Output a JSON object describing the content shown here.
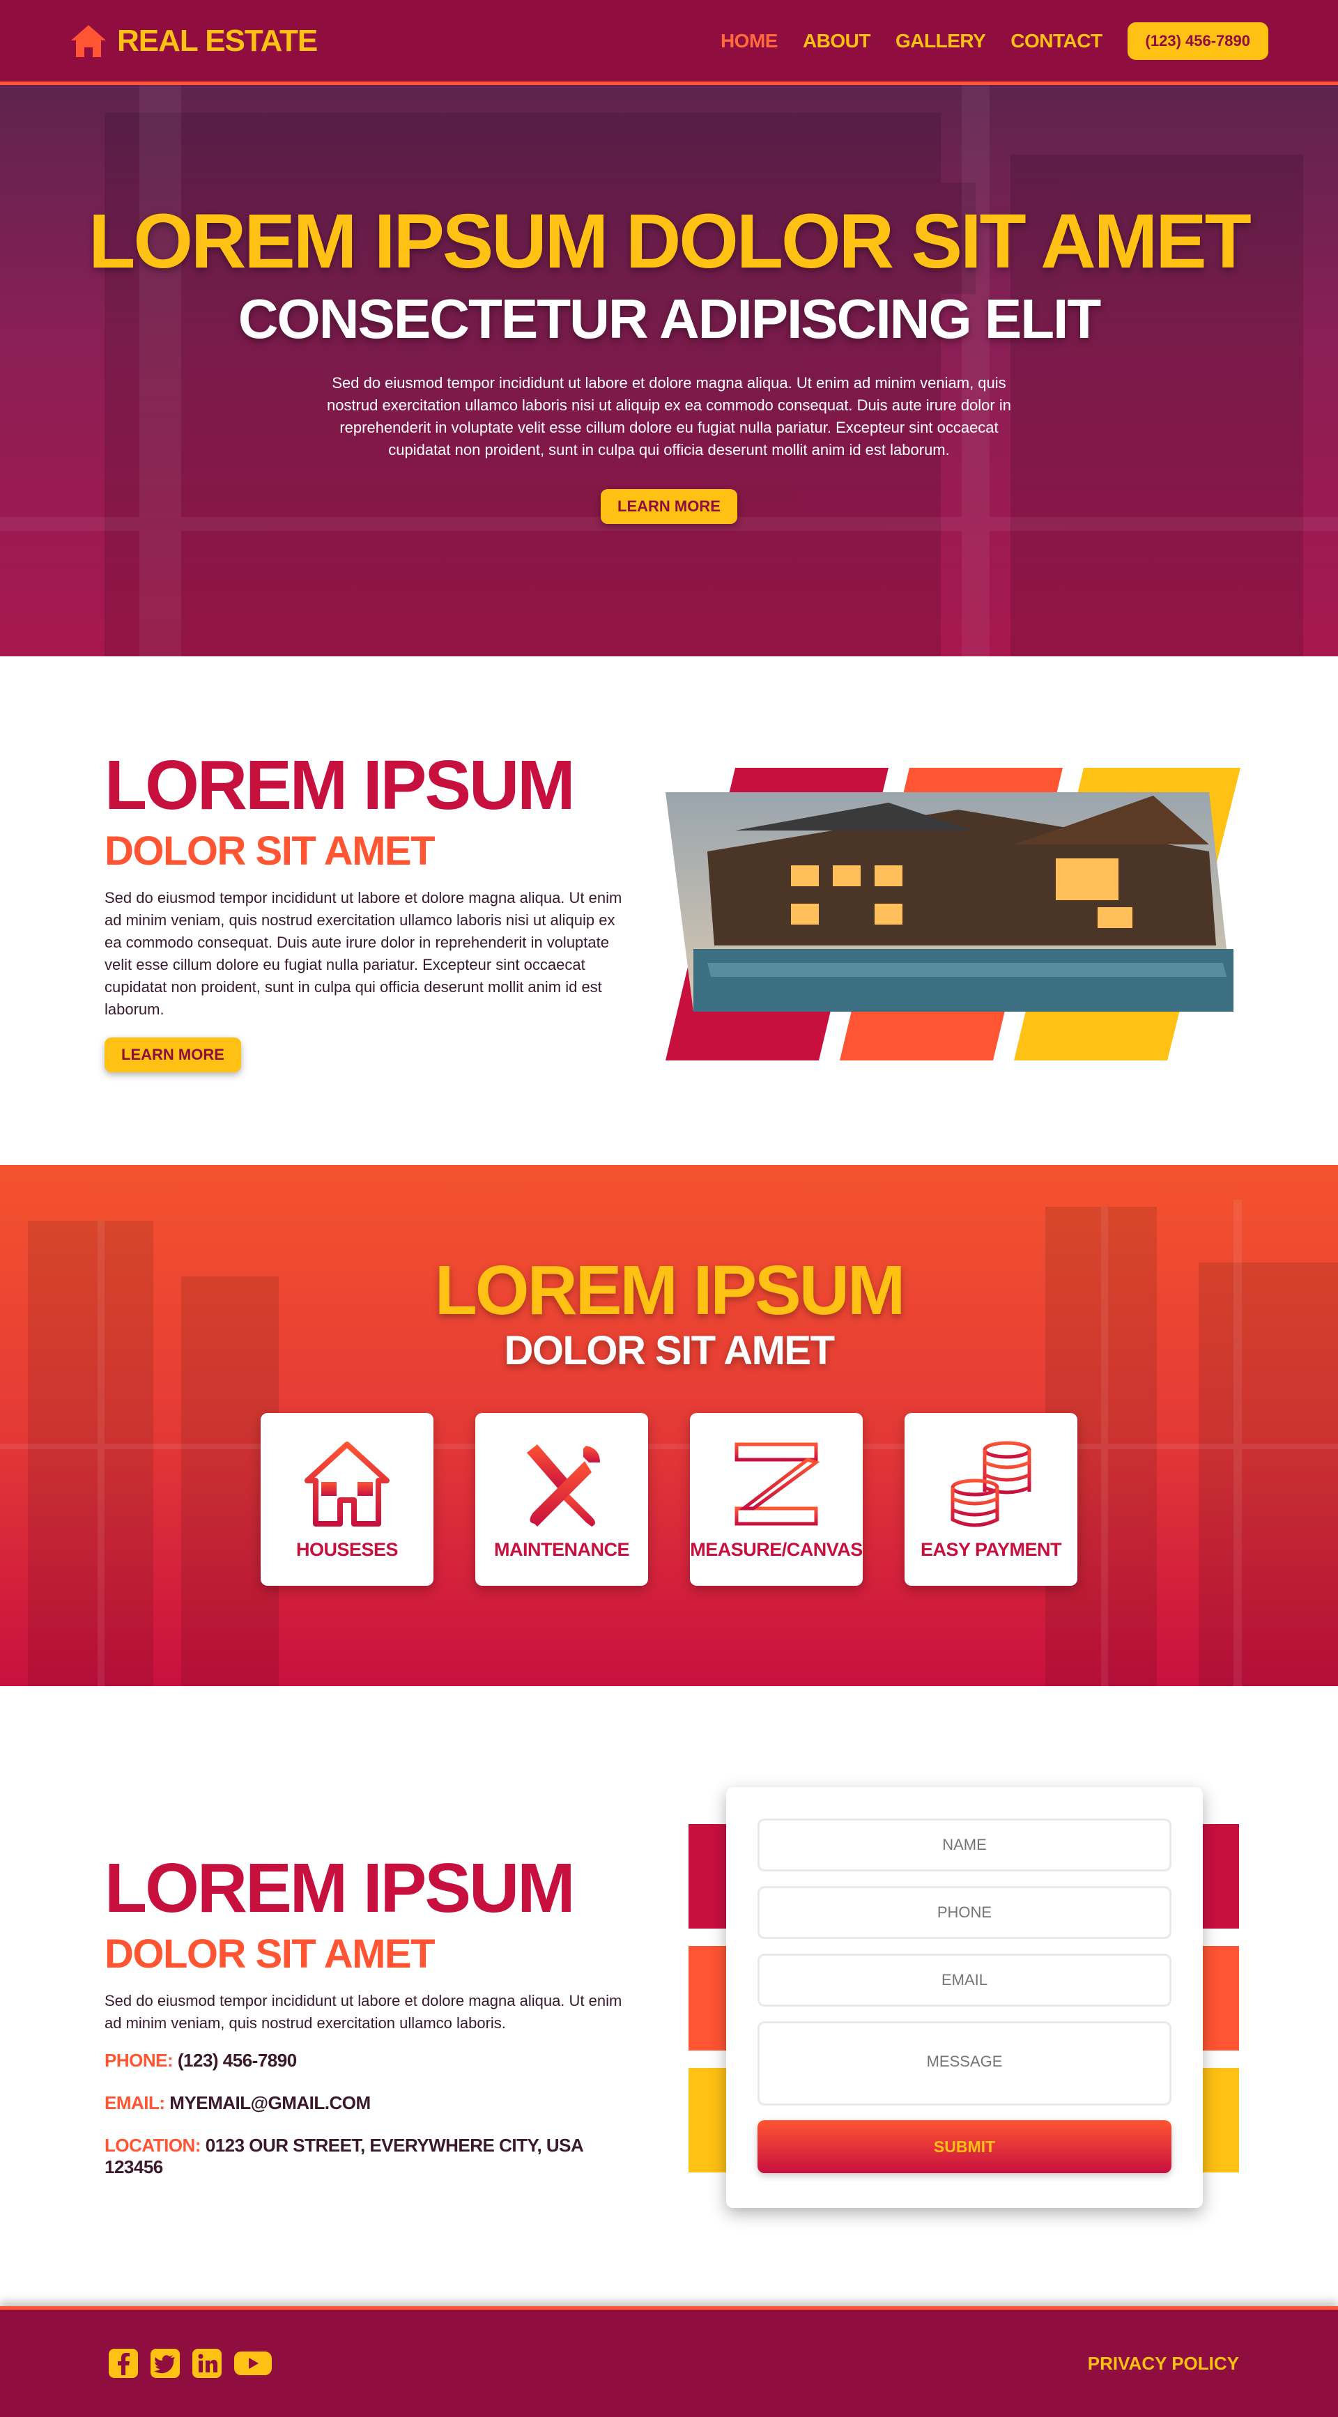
{
  "nav": {
    "brand": "REAL ESTATE",
    "items": [
      {
        "label": "HOME",
        "active": true
      },
      {
        "label": "ABOUT",
        "active": false
      },
      {
        "label": "GALLERY",
        "active": false
      },
      {
        "label": "CONTACT",
        "active": false
      }
    ],
    "phone": "(123) 456-7890"
  },
  "hero": {
    "title": "LOREM IPSUM DOLOR SIT AMET",
    "subtitle": "CONSECTETUR ADIPISCING ELIT",
    "body": "Sed do eiusmod tempor incididunt ut labore et dolore magna aliqua. Ut enim ad minim veniam, quis nostrud exercitation ullamco laboris nisi ut aliquip ex ea commodo consequat. Duis aute irure dolor in reprehenderit in voluptate velit esse cillum dolore eu fugiat nulla pariatur. Excepteur sint occaecat cupidatat non proident, sunt in culpa qui officia deserunt mollit anim id est laborum.",
    "cta": "LEARN MORE"
  },
  "about": {
    "title": "LOREM IPSUM",
    "subtitle": "DOLOR SIT AMET",
    "body": "Sed do eiusmod tempor incididunt ut labore et dolore magna aliqua. Ut enim ad minim veniam, quis nostrud exercitation ullamco laboris nisi ut aliquip ex ea commodo consequat. Duis aute irure dolor in reprehenderit in voluptate velit esse cillum dolore eu fugiat nulla pariatur. Excepteur sint occaecat cupidatat non proident, sunt in culpa qui officia deserunt mollit anim id est laborum.",
    "cta": "LEARN MORE"
  },
  "services": {
    "title": "LOREM IPSUM",
    "subtitle": "DOLOR SIT AMET",
    "cards": [
      {
        "label": "HOUSESES",
        "icon": "house-icon"
      },
      {
        "label": "MAINTENANCE",
        "icon": "tools-icon"
      },
      {
        "label": "MEASURE/CANVAS",
        "icon": "ruler-icon"
      },
      {
        "label": "EASY PAYMENT",
        "icon": "coins-icon"
      }
    ]
  },
  "contact": {
    "title": "LOREM IPSUM",
    "subtitle": "DOLOR SIT AMET",
    "body": "Sed do eiusmod tempor incididunt ut labore et dolore magna aliqua. Ut enim ad minim veniam, quis nostrud exercitation ullamco laboris.",
    "phone_label": "PHONE:",
    "phone": "(123) 456-7890",
    "email_label": "EMAIL:",
    "email": "MYEMAIL@GMAIL.COM",
    "location_label": "LOCATION:",
    "location": "0123 OUR STREET, EVERYWHERE CITY, USA 123456"
  },
  "form": {
    "name_placeholder": "NAME",
    "phone_placeholder": "PHONE",
    "email_placeholder": "EMAIL",
    "message_placeholder": "MESSAGE",
    "submit": "SUBMIT"
  },
  "footer": {
    "socials": [
      "facebook-icon",
      "twitter-icon",
      "linkedin-icon",
      "youtube-icon"
    ],
    "privacy": "PRIVACY POLICY"
  },
  "colors": {
    "primary": "#900d40",
    "crimson": "#c8103f",
    "orange": "#ff5533",
    "yellow": "#ffc113"
  }
}
